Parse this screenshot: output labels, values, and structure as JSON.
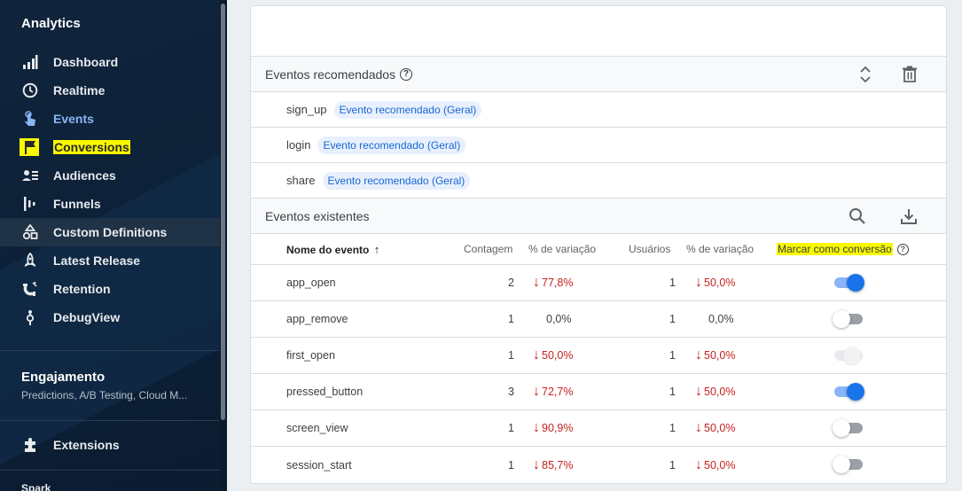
{
  "sidebar": {
    "app_title": "Analytics",
    "items": [
      {
        "label": "Dashboard",
        "icon": "bar-chart-icon"
      },
      {
        "label": "Realtime",
        "icon": "clock-icon"
      },
      {
        "label": "Events",
        "icon": "touch-icon"
      },
      {
        "label": "Conversions",
        "icon": "flag-icon"
      },
      {
        "label": "Audiences",
        "icon": "audience-icon"
      },
      {
        "label": "Funnels",
        "icon": "funnel-icon"
      },
      {
        "label": "Custom Definitions",
        "icon": "shapes-icon"
      },
      {
        "label": "Latest Release",
        "icon": "rocket-icon"
      },
      {
        "label": "Retention",
        "icon": "magnet-icon"
      },
      {
        "label": "DebugView",
        "icon": "debug-icon"
      }
    ],
    "engagement_title": "Engajamento",
    "engagement_sub": "Predictions, A/B Testing, Cloud M...",
    "extensions_label": "Extensions",
    "spark_label": "Spark",
    "colors": {
      "active": "#8ab4f8",
      "highlight": "#f8f800"
    }
  },
  "recommended": {
    "title": "Eventos recomendados",
    "events": [
      {
        "name": "sign_up",
        "chip": "Evento recomendado (Geral)"
      },
      {
        "name": "login",
        "chip": "Evento recomendado (Geral)"
      },
      {
        "name": "share",
        "chip": "Evento recomendado (Geral)"
      }
    ]
  },
  "existing": {
    "title": "Eventos existentes",
    "columns": {
      "name": "Nome do evento",
      "count": "Contagem",
      "count_change": "% de variação",
      "users": "Usuários",
      "users_change": "% de variação",
      "conversion": "Marcar como conversão"
    },
    "rows": [
      {
        "name": "app_open",
        "count": "2",
        "count_change": "77,8%",
        "users": "1",
        "users_change": "50,0%",
        "conversion": "on"
      },
      {
        "name": "app_remove",
        "count": "1",
        "count_change": "0,0%",
        "users": "1",
        "users_change": "0,0%",
        "conversion": "off"
      },
      {
        "name": "first_open",
        "count": "1",
        "count_change": "50,0%",
        "users": "1",
        "users_change": "50,0%",
        "conversion": "disabled"
      },
      {
        "name": "pressed_button",
        "count": "3",
        "count_change": "72,7%",
        "users": "1",
        "users_change": "50,0%",
        "conversion": "on"
      },
      {
        "name": "screen_view",
        "count": "1",
        "count_change": "90,9%",
        "users": "1",
        "users_change": "50,0%",
        "conversion": "off"
      },
      {
        "name": "session_start",
        "count": "1",
        "count_change": "85,7%",
        "users": "1",
        "users_change": "50,0%",
        "conversion": "off"
      }
    ],
    "colors": {
      "decrease": "#c5221f",
      "toggle_on": "#1a73e8"
    }
  }
}
